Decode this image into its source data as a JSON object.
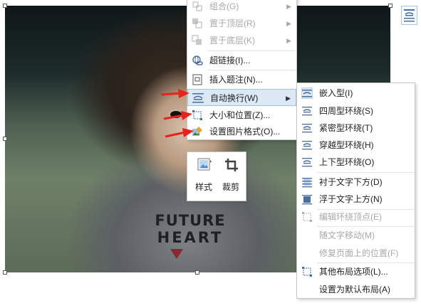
{
  "main_menu": {
    "items": [
      {
        "label": "组合(G)",
        "enabled": false,
        "submenu": true
      },
      {
        "label": "置于顶层(R)",
        "enabled": false,
        "submenu": true
      },
      {
        "label": "置于底层(K)",
        "enabled": false,
        "submenu": true
      },
      {
        "label": "超链接(I)...",
        "enabled": true,
        "submenu": false
      },
      {
        "label": "插入题注(N)...",
        "enabled": true,
        "submenu": false
      },
      {
        "label": "自动换行(W)",
        "enabled": true,
        "submenu": true,
        "highlighted": true
      },
      {
        "label": "大小和位置(Z)...",
        "enabled": true,
        "submenu": false
      },
      {
        "label": "设置图片格式(O)...",
        "enabled": true,
        "submenu": false
      }
    ]
  },
  "mini_toolbar": {
    "style_label": "样式",
    "crop_label": "裁剪"
  },
  "wrap_submenu": {
    "items": [
      {
        "label": "嵌入型(I)",
        "enabled": true,
        "checked": true
      },
      {
        "label": "四周型环绕(S)",
        "enabled": true
      },
      {
        "label": "紧密型环绕(T)",
        "enabled": true
      },
      {
        "label": "穿越型环绕(H)",
        "enabled": true
      },
      {
        "label": "上下型环绕(O)",
        "enabled": true
      },
      {
        "label": "衬于文字下方(D)",
        "enabled": true
      },
      {
        "label": "浮于文字上方(N)",
        "enabled": true
      },
      {
        "label": "编辑环绕顶点(E)",
        "enabled": false
      },
      {
        "label": "随文字移动(M)",
        "enabled": false
      },
      {
        "label": "修复页面上的位置(F)",
        "enabled": false
      },
      {
        "label": "其他布局选项(L)...",
        "enabled": true
      },
      {
        "label": "设置为默认布局(A)",
        "enabled": true
      }
    ]
  },
  "photo": {
    "shirt_text_1": "FUTURE",
    "shirt_text_2": "HEART"
  },
  "colors": {
    "highlight": "#dbe9f7",
    "annotation_arrow": "#e8231f",
    "disabled_text": "#a8a8a8"
  }
}
